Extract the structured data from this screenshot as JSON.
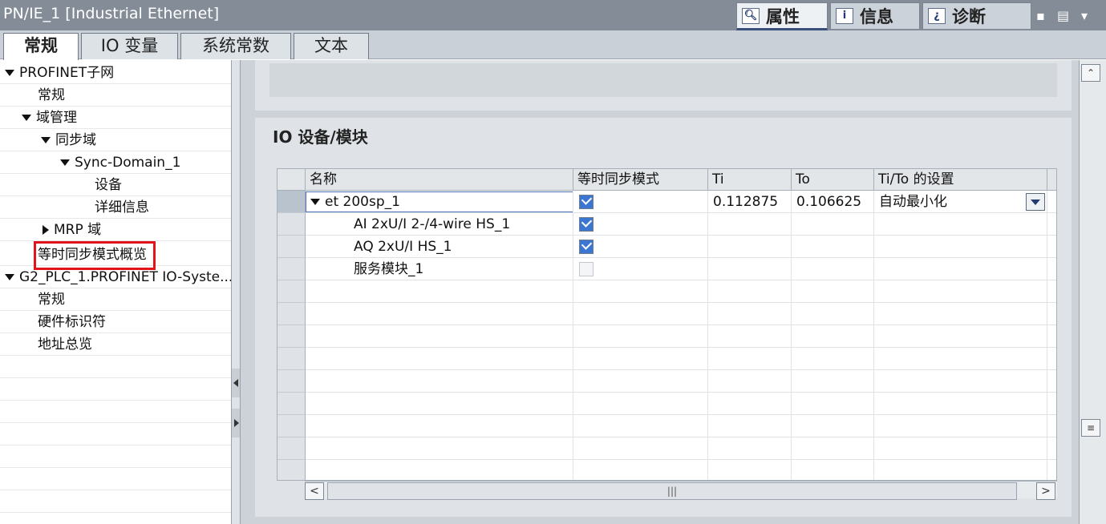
{
  "window": {
    "title": "PN/IE_1 [Industrial Ethernet]"
  },
  "inspector_tabs": [
    {
      "label": "属性",
      "icon": "properties-icon",
      "glyph": "🔍︎"
    },
    {
      "label": "信息",
      "icon": "info-icon",
      "glyph": "i"
    },
    {
      "label": "诊断",
      "icon": "diagnostics-icon",
      "glyph": "¿"
    }
  ],
  "window_controls": [
    "▪",
    "▤",
    "▾"
  ],
  "main_tabs": [
    "常规",
    "IO 变量",
    "系统常数",
    "文本"
  ],
  "tree": {
    "items": [
      {
        "label": "PROFINET子网",
        "indent": 0,
        "toggle": "down"
      },
      {
        "label": "常规",
        "indent": 2,
        "toggle": ""
      },
      {
        "label": "域管理",
        "indent": 1,
        "toggle": "down"
      },
      {
        "label": "同步域",
        "indent": 2,
        "toggle": "down"
      },
      {
        "label": "Sync-Domain_1",
        "indent": 3,
        "toggle": "down"
      },
      {
        "label": "设备",
        "indent": 5,
        "toggle": ""
      },
      {
        "label": "详细信息",
        "indent": 5,
        "toggle": ""
      },
      {
        "label": "MRP 域",
        "indent": 2,
        "toggle": "right"
      },
      {
        "label": "等时同步模式概览",
        "indent": 2,
        "toggle": ""
      },
      {
        "label": "G2_PLC_1.PROFINET IO-Syste...",
        "indent": 0,
        "toggle": "down"
      },
      {
        "label": "常规",
        "indent": 2,
        "toggle": ""
      },
      {
        "label": "硬件标识符",
        "indent": 2,
        "toggle": ""
      },
      {
        "label": "地址总览",
        "indent": 2,
        "toggle": ""
      }
    ]
  },
  "section": {
    "title": "IO 设备/模块"
  },
  "table": {
    "columns": [
      "名称",
      "等时同步模式",
      "Ti",
      "To",
      "Ti/To 的设置"
    ],
    "rows": [
      {
        "name": "et 200sp_1",
        "isochronous": true,
        "ti": "0.112875",
        "to": "0.106625",
        "setting": "自动最小化",
        "level": 0
      },
      {
        "name": "AI 2xU/I 2-/4-wire HS_1",
        "isochronous": true,
        "ti": "",
        "to": "",
        "setting": "",
        "level": 1
      },
      {
        "name": "AQ 2xU/I HS_1",
        "isochronous": true,
        "ti": "",
        "to": "",
        "setting": "",
        "level": 1
      },
      {
        "name": "服务模块_1",
        "isochronous": false,
        "ti": "",
        "to": "",
        "setting": "",
        "level": 1
      }
    ]
  },
  "scroll": {
    "left": "<",
    "right": ">",
    "thumb": "|||",
    "up": "⌃",
    "grip": "≡"
  },
  "colors": {
    "titlebar": "#848d97",
    "checkbox_on": "#3b76d2",
    "highlight_box": "#e1141b"
  }
}
